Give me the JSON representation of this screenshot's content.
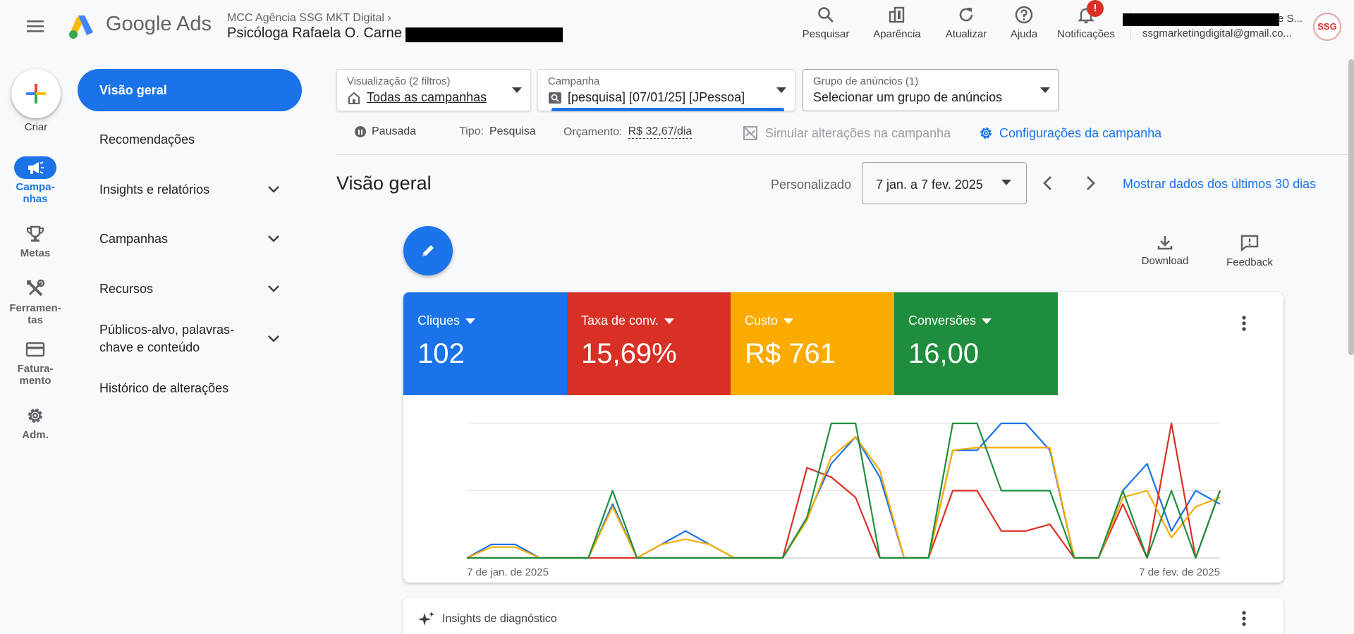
{
  "header": {
    "product_name": "Google Ads",
    "account_path": "MCC Agência SSG MKT Digital",
    "account_name": "Psicóloga Rafaela O. Carne",
    "tools": [
      {
        "label": "Pesquisar",
        "icon": "search-icon"
      },
      {
        "label": "Aparência",
        "icon": "appearance-icon"
      },
      {
        "label": "Atualizar",
        "icon": "refresh-icon"
      },
      {
        "label": "Ajuda",
        "icon": "help-icon"
      },
      {
        "label": "Notificações",
        "icon": "bell-icon"
      }
    ],
    "notification_badge": "!",
    "user_name_fragment": "e S...",
    "user_email": "ssgmarketingdigital@gmail.co...",
    "avatar_text": "SSG"
  },
  "rail": {
    "create_label": "Criar",
    "items": [
      {
        "label": "Campa-\nnhas",
        "icon": "megaphone-icon",
        "active": true
      },
      {
        "label": "Metas",
        "icon": "trophy-icon"
      },
      {
        "label": "Ferramen-\ntas",
        "icon": "tools-icon"
      },
      {
        "label": "Fatura-\nmento",
        "icon": "credit-card-icon"
      },
      {
        "label": "Adm.",
        "icon": "gear-icon"
      }
    ]
  },
  "nav": {
    "items": [
      {
        "label": "Visão geral",
        "active": true
      },
      {
        "label": "Recomendações"
      },
      {
        "label": "Insights e relatórios",
        "expandable": true
      },
      {
        "label": "Campanhas",
        "expandable": true
      },
      {
        "label": "Recursos",
        "expandable": true
      },
      {
        "label": "Públicos-alvo, palavras-\nchave e conteúdo",
        "expandable": true
      },
      {
        "label": "Histórico de alterações"
      }
    ]
  },
  "filters": {
    "view": {
      "label": "Visualização (2 filtros)",
      "value": "Todas as campanhas"
    },
    "campaign": {
      "label": "Campanha",
      "value": "[pesquisa] [07/01/25] [JPessoa]"
    },
    "ad_group": {
      "label": "Grupo de anúncios (1)",
      "value": "Selecionar um grupo de anúncios"
    }
  },
  "campaign_status": {
    "state": "Pausada",
    "type_key": "Tipo:",
    "type_value": "Pesquisa",
    "budget_key": "Orçamento:",
    "budget_value": "R$ 32,67/dia",
    "simulate": "Simular alterações na campanha",
    "settings": "Configurações da campanha"
  },
  "overview": {
    "title": "Visão geral",
    "date_prefix": "Personalizado",
    "date_range": "7 jan. a 7 fev. 2025",
    "last30": "Mostrar dados dos últimos 30 dias",
    "download": "Download",
    "feedback": "Feedback"
  },
  "colors": {
    "blue": "#1a73e8",
    "red": "#d93025",
    "yellow": "#f9ab00",
    "green": "#1e8e3e"
  },
  "metrics": [
    {
      "label": "Cliques",
      "value": "102",
      "color": "#1a73e8"
    },
    {
      "label": "Taxa de conv.",
      "value": "15,69%",
      "color": "#d93025"
    },
    {
      "label": "Custo",
      "value": "R$ 761",
      "color": "#f9ab00"
    },
    {
      "label": "Conversões",
      "value": "16,00",
      "color": "#1e8e3e"
    }
  ],
  "chart_data": {
    "type": "line",
    "x_start_label": "7 de jan. de 2025",
    "x_end_label": "7 de fev. de 2025",
    "grid": true,
    "series": [
      {
        "name": "Cliques",
        "color": "#1a73e8",
        "values": [
          0,
          0.1,
          0.1,
          0,
          0,
          0,
          0.4,
          0,
          0.1,
          0.2,
          0.1,
          0,
          0,
          0,
          0.3,
          0.7,
          0.9,
          0.6,
          0,
          0,
          0.8,
          0.8,
          1,
          1,
          0.8,
          0,
          0,
          0.5,
          0.7,
          0.2,
          0.5,
          0.4
        ]
      },
      {
        "name": "Taxa de conv.",
        "color": "#d93025",
        "values": [
          0,
          0,
          0,
          0,
          0,
          0,
          0,
          0,
          0,
          0,
          0,
          0,
          0,
          0,
          0.67,
          0.6,
          0.45,
          0,
          0,
          0,
          0.5,
          0.5,
          0.2,
          0.2,
          0.25,
          0,
          0,
          0.4,
          0,
          1,
          0,
          0.5
        ]
      },
      {
        "name": "Custo",
        "color": "#f9ab00",
        "values": [
          0,
          0.08,
          0.08,
          0,
          0,
          0,
          0.38,
          0,
          0.1,
          0.14,
          0.1,
          0,
          0,
          0,
          0.28,
          0.75,
          0.9,
          0.65,
          0,
          0,
          0.8,
          0.82,
          0.82,
          0.82,
          0.82,
          0,
          0,
          0.45,
          0.5,
          0.15,
          0.38,
          0.45
        ]
      },
      {
        "name": "Conversões",
        "color": "#1e8e3e",
        "values": [
          0,
          0,
          0,
          0,
          0,
          0,
          0.5,
          0,
          0,
          0,
          0,
          0,
          0,
          0,
          0.3,
          1,
          1,
          0,
          0,
          0,
          1,
          1,
          0.5,
          0.5,
          0.5,
          0,
          0,
          0.5,
          0,
          0.5,
          0,
          0.5
        ]
      }
    ]
  },
  "insights": {
    "title": "Insights de diagnóstico"
  }
}
